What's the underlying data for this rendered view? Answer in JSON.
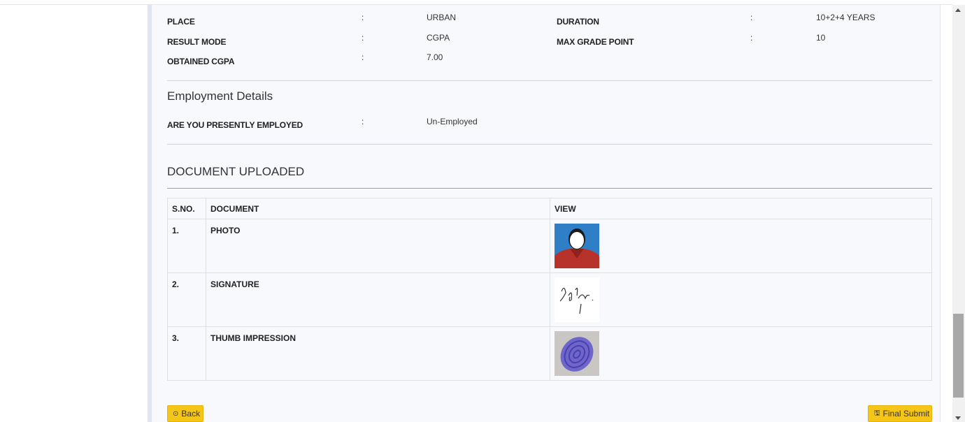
{
  "education": {
    "place_label": "PLACE",
    "place_value": "URBAN",
    "duration_label": "DURATION",
    "duration_value": "10+2+4 YEARS",
    "result_mode_label": "RESULT MODE",
    "result_mode_value": "CGPA",
    "max_grade_label": "MAX GRADE POINT",
    "max_grade_value": "10",
    "cgpa_label": "OBTAINED CGPA",
    "cgpa_value": "7.00",
    "separator": ":"
  },
  "employment": {
    "title": "Employment Details",
    "employed_label": "ARE YOU PRESENTLY EMPLOYED",
    "employed_value": "Un-Employed"
  },
  "documents": {
    "title": "DOCUMENT UPLOADED",
    "headers": [
      "S.NO.",
      "DOCUMENT",
      "VIEW"
    ],
    "rows": [
      {
        "sno": "1.",
        "name": "PHOTO",
        "view_icon": "photo-thumbnail"
      },
      {
        "sno": "2.",
        "name": "SIGNATURE",
        "view_icon": "signature-thumbnail"
      },
      {
        "sno": "3.",
        "name": "THUMB IMPRESSION",
        "view_icon": "thumb-impression-thumbnail"
      }
    ]
  },
  "actions": {
    "back_label": "Back",
    "back_icon": "circle-arrow-icon",
    "submit_label": "Final Submit",
    "submit_icon": "floppy-disk-icon",
    "button_color": "#f5c518"
  }
}
